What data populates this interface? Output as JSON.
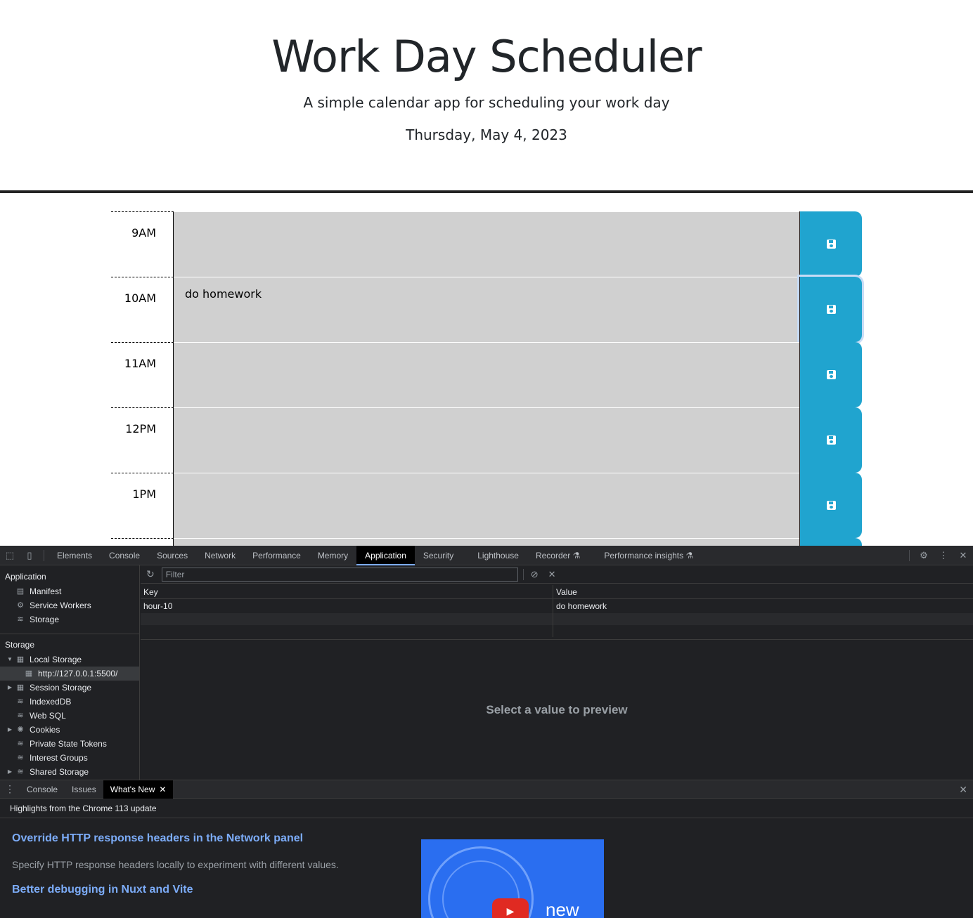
{
  "app": {
    "title": "Work Day Scheduler",
    "lead": "A simple calendar app for scheduling your work day",
    "current_date": "Thursday, May 4, 2023"
  },
  "schedule": [
    {
      "hour": "9AM",
      "text": ""
    },
    {
      "hour": "10AM",
      "text": "do homework"
    },
    {
      "hour": "11AM",
      "text": ""
    },
    {
      "hour": "12PM",
      "text": ""
    },
    {
      "hour": "1PM",
      "text": ""
    },
    {
      "hour": "",
      "text": ""
    }
  ],
  "colors": {
    "past_block": "#d0d0d0",
    "save_button": "#20a4cf",
    "devtools_bg": "#202124",
    "link": "#7cacf8"
  },
  "devtools": {
    "tabs": [
      "Elements",
      "Console",
      "Sources",
      "Network",
      "Performance",
      "Memory",
      "Application",
      "Security",
      "Lighthouse",
      "Recorder",
      "Performance insights"
    ],
    "active_tab": "Application",
    "sidebar": {
      "application_header": "Application",
      "application_items": [
        "Manifest",
        "Service Workers",
        "Storage"
      ],
      "storage_header": "Storage",
      "local_storage": "Local Storage",
      "local_storage_origin": "http://127.0.0.1:5500/",
      "storage_items": [
        "Session Storage",
        "IndexedDB",
        "Web SQL",
        "Cookies",
        "Private State Tokens",
        "Interest Groups",
        "Shared Storage"
      ]
    },
    "filter_placeholder": "Filter",
    "table": {
      "headers": {
        "key": "Key",
        "value": "Value"
      },
      "rows": [
        {
          "key": "hour-10",
          "value": "do homework"
        }
      ]
    },
    "preview_text": "Select a value to preview",
    "drawer": {
      "tabs": [
        "Console",
        "Issues",
        "What's New"
      ],
      "active_tab": "What's New",
      "header": "Highlights from the Chrome 113 update",
      "items": [
        {
          "title": "Override HTTP response headers in the Network panel",
          "description": "Specify HTTP response headers locally to experiment with different values."
        },
        {
          "title": "Better debugging in Nuxt and Vite",
          "description": ""
        }
      ],
      "video_label": "new"
    }
  }
}
